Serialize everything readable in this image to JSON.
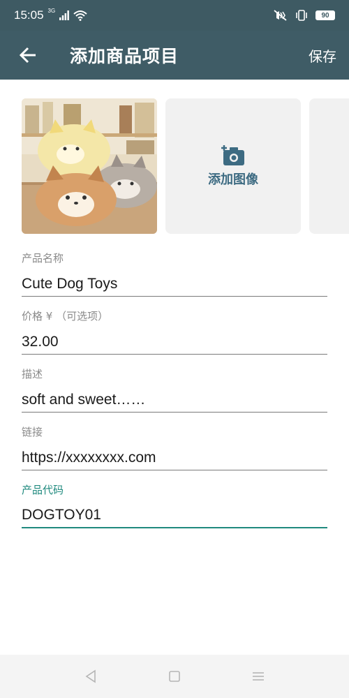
{
  "status_bar": {
    "time": "15:05",
    "network_label": "3G",
    "battery_level": "90"
  },
  "app_bar": {
    "title": "添加商品项目",
    "save_label": "保存"
  },
  "images": {
    "add_image_label": "添加图像"
  },
  "form": {
    "fields": [
      {
        "label": "产品名称",
        "value": "Cute Dog Toys"
      },
      {
        "label": "价格 ¥ （可选项）",
        "value": "32.00"
      },
      {
        "label": "描述",
        "value": "soft and sweet……"
      },
      {
        "label": "链接",
        "value": "https://xxxxxxxx.com"
      },
      {
        "label": "产品代码",
        "value": "DOGTOY01"
      }
    ]
  },
  "colors": {
    "app_bar": "#3f5c66",
    "accent": "#1f8a7e",
    "add_image_text": "#3d6b82"
  }
}
